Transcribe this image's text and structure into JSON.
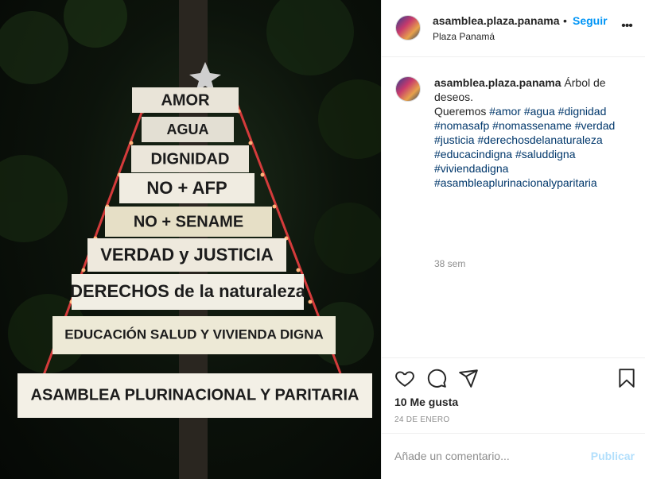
{
  "photo": {
    "banners": [
      "AMOR",
      "AGUA",
      "DIGNIDAD",
      "NO + AFP",
      "NO + SENAME",
      "VERDAD y JUSTICIA",
      "DERECHOS de la naturaleza",
      "EDUCACIÓN SALUD Y VIVIENDA DIGNA",
      "ASAMBLEA PLURINACIONAL Y PARITARIA"
    ]
  },
  "header": {
    "username": "asamblea.plaza.panama",
    "separator": "•",
    "follow_label": "Seguir",
    "location": "Plaza Panamá",
    "more_label": "•••"
  },
  "caption": {
    "username": "asamblea.plaza.panama",
    "text_line1": "Árbol de deseos.",
    "text_line2": "Queremos",
    "hashtags": [
      "#amor",
      "#agua",
      "#dignidad",
      "#nomasafp",
      "#nomassename",
      "#verdad",
      "#justicia",
      "#derechosdelanaturaleza",
      "#educacindigna",
      "#saluddigna",
      "#viviendadigna",
      "#asambleaplurinacionalyparitaria"
    ],
    "time": "38 sem"
  },
  "actions": {
    "likes": "10 Me gusta",
    "date": "24 DE ENERO"
  },
  "comment": {
    "placeholder": "Añade un comentario...",
    "publish_label": "Publicar"
  },
  "colors": {
    "link": "#0095f6",
    "hashtag": "#00376b",
    "publish_disabled": "#b2dffc",
    "muted": "#8e8e8e"
  }
}
